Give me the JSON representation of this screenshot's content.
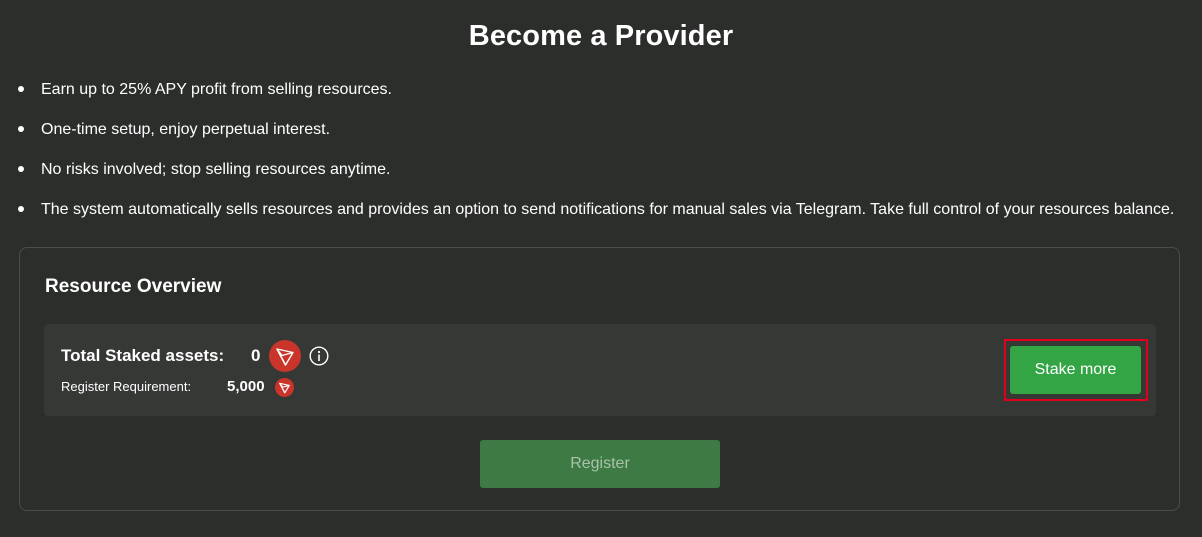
{
  "page": {
    "title": "Become a Provider"
  },
  "bullets": [
    "Earn up to 25% APY profit from selling resources.",
    "One-time setup, enjoy perpetual interest.",
    "No risks involved; stop selling resources anytime.",
    "The system automatically sells resources and provides an option to send notifications for manual sales via Telegram. Take full control of your resources balance."
  ],
  "overview": {
    "title": "Resource Overview",
    "total_staked_label": "Total Staked assets:",
    "total_staked_value": "0",
    "register_requirement_label": "Register Requirement:",
    "register_requirement_value": "5,000",
    "token_icon": "tron-icon",
    "info_icon": "info-icon",
    "stake_more_label": "Stake more",
    "register_label": "Register",
    "register_disabled": true
  },
  "colors": {
    "background": "#2b2e2b",
    "panel": "#353835",
    "accent_green": "#33a545",
    "disabled_green": "#3e7a44",
    "tron_red": "#c9352b",
    "highlight_red": "#e3001b"
  }
}
